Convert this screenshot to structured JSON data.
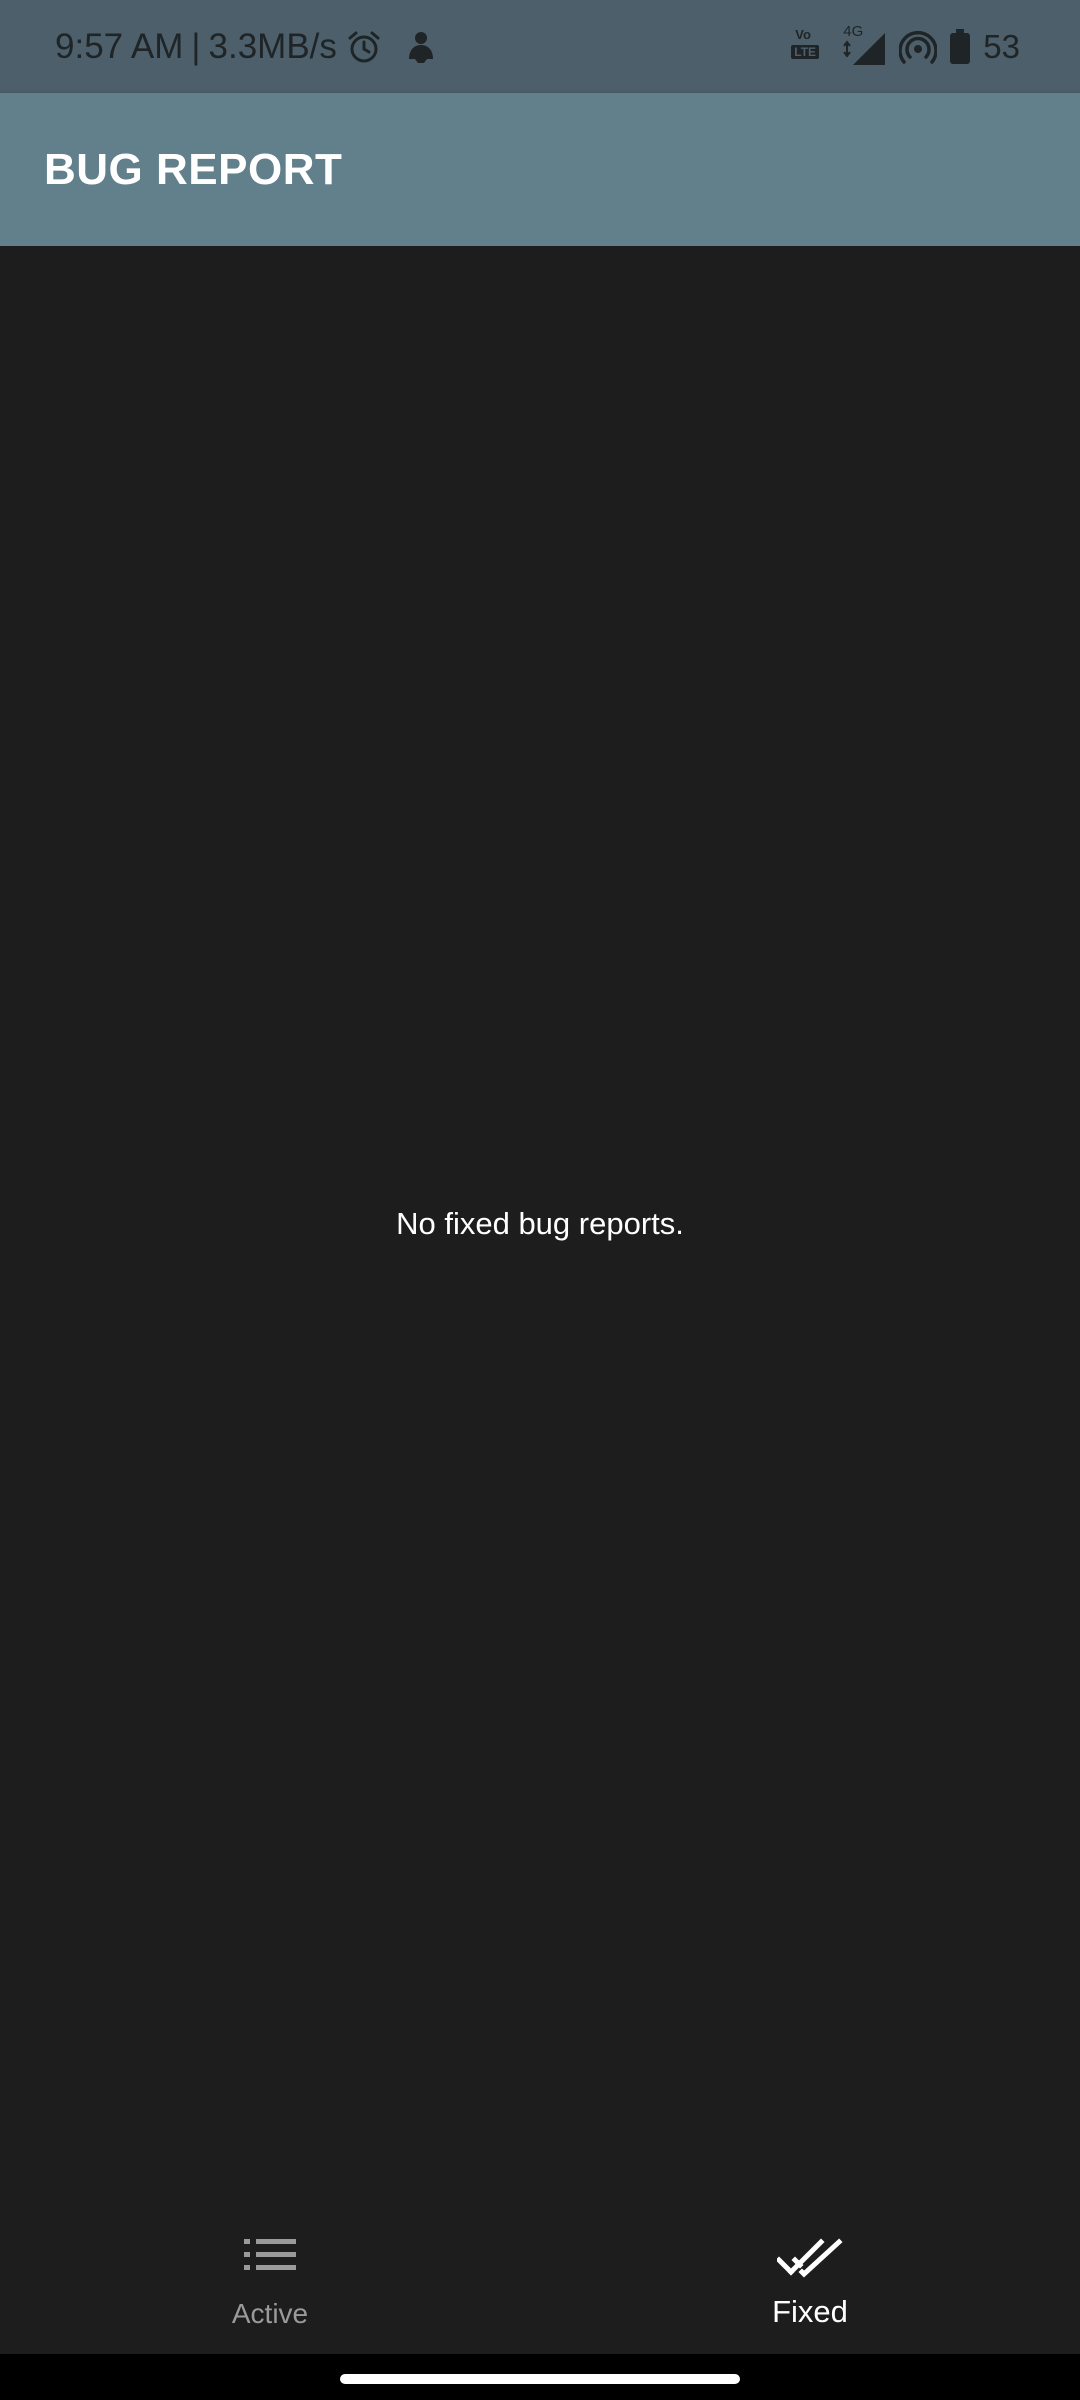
{
  "status_bar": {
    "time": "9:57 AM",
    "separator": "|",
    "speed": "3.3MB/s",
    "network_type": "4G",
    "volte_label": "Vo",
    "lte_label": "LTE",
    "battery": "53",
    "icons": [
      "alarm-icon",
      "notification-icon",
      "volte-icon",
      "signal-icon",
      "hotspot-icon",
      "battery-icon"
    ]
  },
  "app_bar": {
    "title": "BUG REPORT"
  },
  "content": {
    "empty_message": "No fixed bug reports."
  },
  "bottom_nav": {
    "items": [
      {
        "label": "Active",
        "icon": "list-icon",
        "selected": false
      },
      {
        "label": "Fixed",
        "icon": "double-check-icon",
        "selected": true
      }
    ]
  },
  "colors": {
    "status_bar": "#4c5f6b",
    "app_bar": "#627f8c",
    "background": "#1d1d1e",
    "selected_text": "#ffffff",
    "inactive_text": "#9a9a9a"
  }
}
